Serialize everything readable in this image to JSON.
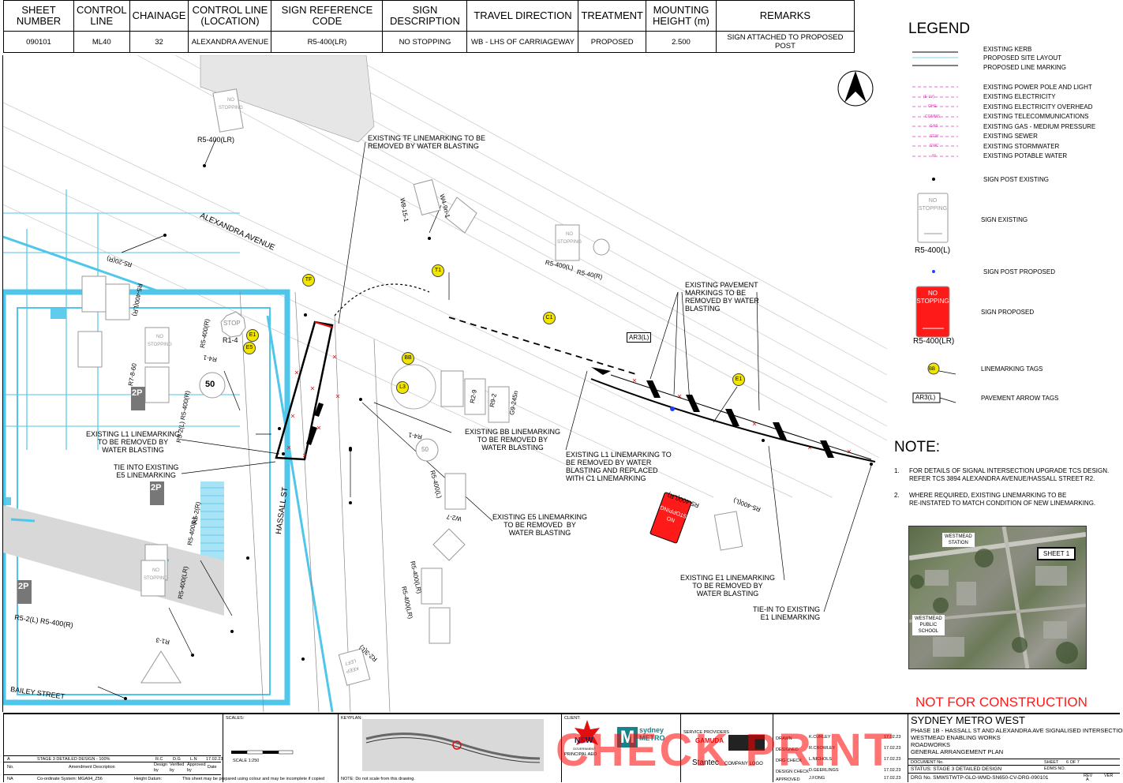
{
  "header_table": {
    "headers": [
      "SHEET\nNUMBER",
      "CONTROL\nLINE",
      "CHAINAGE",
      "CONTROL LINE\n(LOCATION)",
      "SIGN REFERENCE\nCODE",
      "SIGN\nDESCRIPTION",
      "TRAVEL DIRECTION",
      "TREATMENT",
      "MOUNTING\nHEIGHT (m)",
      "REMARKS"
    ],
    "row": [
      "090101",
      "ML40",
      "32",
      "ALEXANDRA AVENUE",
      "R5-400(LR)",
      "NO STOPPING",
      "WB - LHS OF CARRIAGEWAY",
      "PROPOSED",
      "2.500",
      "SIGN ATTACHED TO PROPOSED POST"
    ]
  },
  "drawing": {
    "streets": {
      "alexandra": "ALEXANDRA AVENUE",
      "hassall": "HASSALL ST",
      "bailey": "BAILEY STREET"
    },
    "callouts": {
      "tf_remove": "EXISTING TF LINEMARKING TO BE\nREMOVED BY WATER BLASTING",
      "pavement_remove": "EXISTING PAVEMENT\nMARKINGS TO BE\nREMOVED BY WATER\nBLASTING",
      "bb_remove": "EXISTING BB LINEMARKING\nTO BE REMOVED BY\nWATER BLASTING",
      "l1_remove": "EXISTING L1 LINEMARKING\nTO BE REMOVED BY\nWATER BLASTING",
      "tie_e5": "TIE INTO EXISTING\nE5 LINEMARKING",
      "l1_replace": "EXISTING L1 LINEMARKING TO\nBE REMOVED BY WATER\nBLASTING AND REPLACED\nWITH C1 LINEMARKING",
      "e5_remove": "EXISTING E5 LINEMARKING\nTO BE REMOVED  BY\nWATER BLASTING",
      "e1_remove": "EXISTING E1 LINEMARKING\nTO BE REMOVED BY\nWATER BLASTING",
      "tie_e1": "TIE-IN TO EXISTING\nE1 LINEMARKING"
    },
    "tags": {
      "tf": "TF",
      "t1": "T1",
      "c1": "C1",
      "e1": "E1",
      "e5": "E5",
      "bb": "BB",
      "l3": "L3",
      "e1b": "E1"
    },
    "arrow_tag": "AR3(L)",
    "sign_codes": {
      "r5_400lr_top": "R5-400(LR)",
      "w8_15_1": "W8-15-1",
      "w4_9n_1": "W4-9n-1",
      "r5_400l": "R5-400(L)",
      "r5_40r": "R5-40(R)",
      "r1_4": "R1-4",
      "r4_1": "R4-1",
      "r4_1b": "R4-1",
      "r2_9": "R2-9",
      "r9_2": "R9-2",
      "g9_245n": "G9-245n",
      "r5_400l_mid": "R5-400(L)",
      "w2_7": "W2-7",
      "r5_400lr_mid": "R5-400(LR)",
      "r5_400lr_mid2": "R5-400(LR)",
      "r5_400lr_prop": "R5-400(LR)",
      "r5_400l_right": "R5-400(L)",
      "r5_2l_r5_400r": "R5-2(L) R5-400(R)",
      "r5_400l_bottom": "R5-400(L)",
      "r5_2r": "R5-2(R)",
      "r5_400lr_left": "R5-400(LR)",
      "r5_2l_r5_400r_b": "R5-2(L) R5-400(R)",
      "r1_3": "R1-3",
      "r2_3l": "R2-3(L)",
      "r7_8_60": "R7-8-60",
      "r5_20r": "R5-20(R)",
      "r5_400lr_a": "R5-400(LR)",
      "r5_400r": "R5-400(R)"
    },
    "sign_faces": {
      "no_stopping": "NO\nSTOPPING",
      "stop": "STOP",
      "speed": "50",
      "two_p": "2P",
      "keep_left": "KEEP\nLEFT"
    }
  },
  "legend": {
    "title": "LEGEND",
    "items": [
      "EXISTING KERB",
      "PROPOSED SITE LAYOUT",
      "PROPOSED LINE MARKING",
      "EXISTING POWER POLE AND LIGHT",
      "EXISTING  ELECTRICITY",
      "EXISTING  ELECTRICITY OVERHEAD",
      "EXISTING TELECOMMUNICATIONS",
      "EXISTING GAS - MEDIUM PRESSURE",
      "EXISTING SEWER",
      "EXISTING STORMWATER",
      "EXISTING POTABLE WATER",
      "SIGN POST EXISTING",
      "SIGN EXISTING",
      "SIGN POST PROPOSED",
      "SIGN PROPOSED",
      "LINEMARKING TAGS",
      "PAVEMENT ARROW TAGS"
    ],
    "line_codes": [
      "(E-LV)",
      "OHE",
      "COMMS",
      "GAS",
      "SEW",
      "SWC",
      "W"
    ],
    "sign_existing_code": "R5-400(L)",
    "sign_proposed_code": "R5-400(LR)",
    "sign_face": "NO\nSTOPPING",
    "tag_example": "BB",
    "arrow_example": "AR3(L)",
    "colors": {
      "proposed_sign": "#ff1a1a",
      "tag": "#f2e600",
      "existing_service": "#e040c0",
      "site_layout": "#50c8e8"
    }
  },
  "notes": {
    "title": "NOTE:",
    "items": [
      {
        "num": "1.",
        "text": "FOR DETAILS OF SIGNAL INTERSECTION UPGRADE TCS DESIGN.\nREFER TCS 3894 ALEXANDRA AVENUE/HASSALL STREET R2."
      },
      {
        "num": "2.",
        "text": "WHERE REQUIRED, EXISTING LINEMARKING TO BE\nRE-INSTATED TO MATCH CONDITION OF NEW LINEMARKING."
      }
    ]
  },
  "keymap": {
    "labels": {
      "station": "WESTMEAD\nSTATION",
      "sheet": "SHEET 1",
      "school": "WESTMEAD\nPUBLIC\nSCHOOL"
    }
  },
  "not_for_construction": "NOT FOR CONSTRUCTION",
  "title_block": {
    "amendment_row": {
      "rev": "A",
      "desc": "STAGE 3 DETAILED DESIGN - 100%",
      "design": "R.C",
      "verified": "D.G",
      "approved": "L.N",
      "date": "17.02.23"
    },
    "columns": {
      "no": "No.",
      "desc": "Amendment Description",
      "design": "Design\nby",
      "verified": "Verified\nby",
      "approved": "Approved\nby",
      "date": "Date"
    },
    "na": "NA",
    "coord": "Co-ordinate System: MGA94_Z56",
    "height": "Height Datum:",
    "colour_note": "This sheet may be prepared using colour and may be incomplete if copied",
    "scale_note": "NOTE: Do not scale from this drawing.",
    "scales_label": "SCALES:",
    "scale_bar": "SCALE 1:250",
    "keyplan_label": "KEYPLAN:",
    "client_label": "CLIENT:",
    "principal": "PRINCIPAL AEO",
    "nsw": "NSW",
    "nsw_sub": "GOVERNMENT",
    "metro": "sydney\nMETRO",
    "service_providers": "SERVICE PROVIDERS",
    "gamuda": "GAMUDA",
    "stantec": "Stantec",
    "company_logo": "COMPANY LOGO",
    "drawn": "DRAWN",
    "drawn_by": "K.CURLEY",
    "designed": "DESIGNED",
    "designed_by": "R.CROWLEY",
    "drg_check": "DRG CHECK",
    "drg_check_by": "L.NICHOLS",
    "design_check": "DESIGN CHECK",
    "design_check_by": "D.GEERLINGS",
    "approved": "APPROVED",
    "approved_by": "J.FONG",
    "date": "17.02.23",
    "project": "SYDNEY METRO WEST",
    "phase": "PHASE 1B - HASSALL ST AND ALEXANDRA AVE SIGNALISED INTERSECTION",
    "works": "WESTMEAD ENABLING WORKS",
    "roadworks": "ROADWORKS",
    "gap": "GENERAL ARRANGEMENT PLAN",
    "document_no": "DOCUMENT No.",
    "sheet_label": "SHEET",
    "sheet_val": "6 OF 7",
    "status": "STATUS: STAGE 3 DETAILED DESIGN",
    "edms": "EDMS NO.",
    "drg_no": "DRG No.  SMWSTWTP-GLO-WMD-SN650-CV-DRG-090101",
    "rev_label": "REV",
    "rev_val": "A",
    "ver_label": "VER",
    "check_print": "CHECK PRINT"
  }
}
